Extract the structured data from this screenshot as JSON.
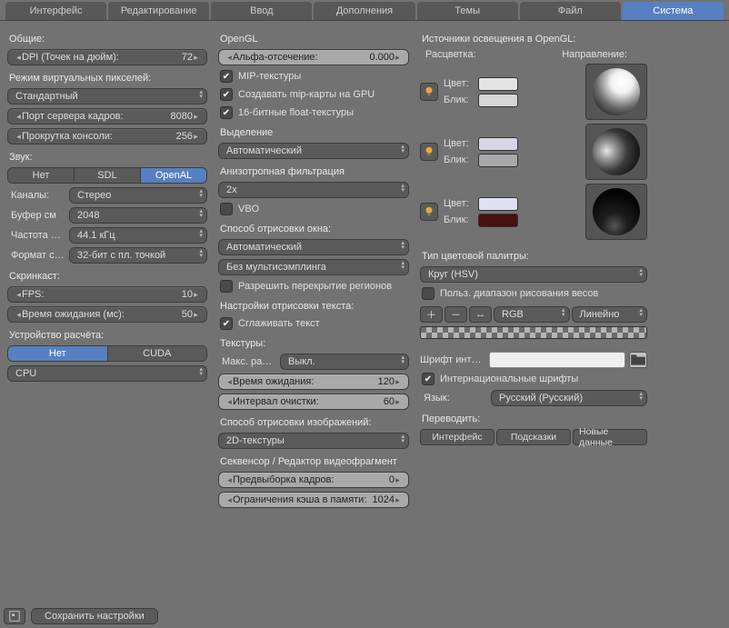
{
  "tabs": [
    "Интерфейс",
    "Редактирование",
    "Ввод",
    "Дополнения",
    "Темы",
    "Файл",
    "Система"
  ],
  "active_tab": 6,
  "col1": {
    "general_label": "Общие:",
    "dpi_label": "DPI (Точек на дюйм):",
    "dpi_value": "72",
    "vpix_label": "Режим виртуальных пикселей:",
    "vpix_value": "Стандартный",
    "frameserver_label": "Порт сервера кадров:",
    "frameserver_value": "8080",
    "console_label": "Прокрутка консоли:",
    "console_value": "256",
    "sound_label": "Звук:",
    "sound_options": [
      "Нет",
      "SDL",
      "OpenAL"
    ],
    "sound_active": 2,
    "channels_label": "Каналы:",
    "channels_value": "Стерео",
    "bufsize_label": "Буфер см",
    "bufsize_value": "2048",
    "rate_label": "Частота д…",
    "rate_value": "44.1 кГц",
    "format_label": "Формат с…",
    "format_value": "32-бит с пл. точкой",
    "screencast_label": "Скринкаст:",
    "fps_label": "FPS:",
    "fps_value": "10",
    "wait_label": "Время ожидания (мс):",
    "wait_value": "50",
    "compute_label": "Устройство расчёта:",
    "compute_options": [
      "Нет",
      "CUDA"
    ],
    "compute_active": 0,
    "cpu_value": "CPU"
  },
  "col2": {
    "opengl_label": "OpenGL",
    "alpha_clip_label": "Альфа-отсечение:",
    "alpha_clip_value": "0.000",
    "mipmaps": "MIP-текстуры",
    "gpu_mip": "Создавать mip-карты на GPU",
    "float16": "16-битные float-текстуры",
    "selection_label": "Выделение",
    "selection_value": "Автоматический",
    "aniso_label": "Анизотропная фильтрация",
    "aniso_value": "2x",
    "vbo": "VBO",
    "winmethod_label": "Способ отрисовки окна:",
    "winmethod_value": "Автоматический",
    "multisample_value": "Без мультисэмплинга",
    "region_overlap": "Разрешить перекрытие регионов",
    "textdraw_label": "Настройки отрисовки текста:",
    "textaa": "Сглаживать текст",
    "textures_label": "Текстуры:",
    "texsize_label": "Макс. раз…",
    "texsize_value": "Выкл.",
    "texwait_label": "Время ожидания:",
    "texwait_value": "120",
    "texgc_label": "Интервал очистки:",
    "texgc_value": "60",
    "imgmethod_label": "Способ отрисовки изображений:",
    "imgmethod_value": "2D-текстуры",
    "sequencer_label": "Секвенсор / Редактор видеофрагмент",
    "prefetch_label": "Предвыборка кадров:",
    "prefetch_value": "0",
    "memcache_label": "Ограничения кэша в памяти:",
    "memcache_value": "1024"
  },
  "col3": {
    "lights_label": "Источники освещения в OpenGL:",
    "colors_hdr": "Расцветка:",
    "direction_hdr": "Направление:",
    "color_label": "Цвет:",
    "spec_label": "Блик:",
    "lights": [
      {
        "on": true,
        "diff": "#e4e4e4",
        "spec": "#d6d6d6",
        "sphere_style": "radial-gradient(circle at 62% 30%, #ffffff 0%, #f2f2f2 24%, #6b6b6b 58%, #141414 92%)"
      },
      {
        "on": true,
        "diff": "#d6d6e6",
        "spec": "#a9a9a9",
        "sphere_style": "radial-gradient(circle at 30% 48%, #e6e6e6 0%, #9a9a9a 20%, #3a3a3a 50%, #0c0c0c 88%)"
      },
      {
        "on": true,
        "diff": "#e0e0f2",
        "spec": "#4a0f0f",
        "sphere_style": "radial-gradient(circle at 46% 80%, #555 0%, #1e1e1e 28%, #050505 70%)"
      }
    ],
    "picker_type_label": "Тип цветовой палитры:",
    "picker_type_value": "Круг (HSV)",
    "custom_range": "Польз. диапазон рисования весов",
    "tb_add": "＋",
    "tb_del": "－",
    "tb_flip": "↔",
    "ramp_mode": "RGB",
    "ramp_interp": "Линейно",
    "font_label": "Шрифт инт…",
    "intl_fonts": "Интернациональные шрифты",
    "lang_label": "Язык:",
    "lang_value": "Русский (Русский)",
    "translate_label": "Переводить:",
    "translate_options": [
      "Интерфейс",
      "Подсказки",
      "Новые данные"
    ]
  },
  "footer": {
    "save": "Сохранить настройки"
  }
}
